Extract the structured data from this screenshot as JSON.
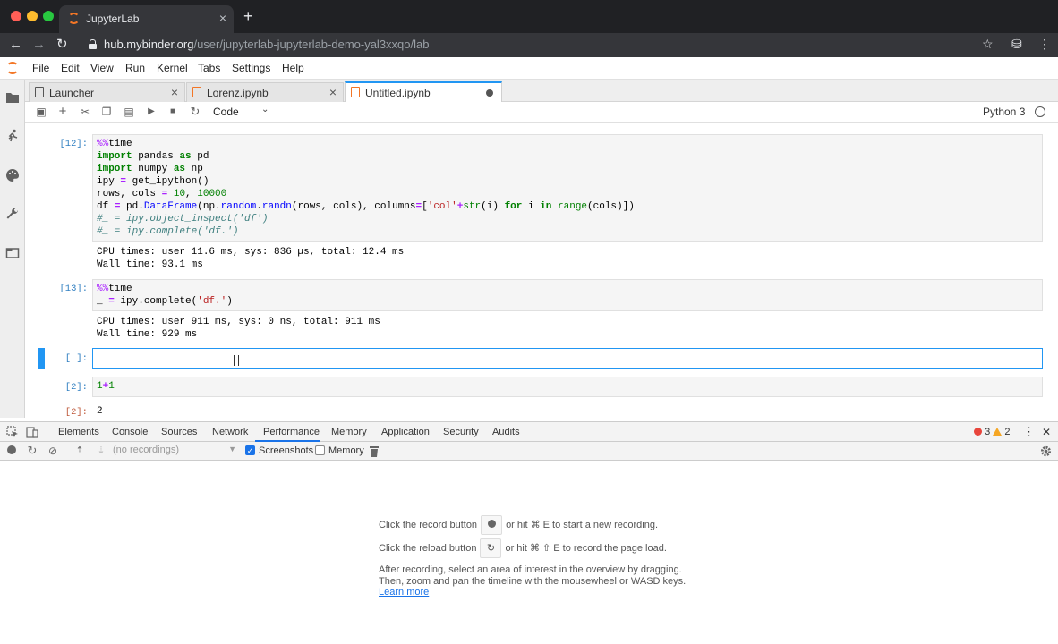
{
  "browser": {
    "tab_title": "JupyterLab",
    "tab_close": "×",
    "new_tab": "+",
    "back": "←",
    "forward": "→",
    "reload": "↻",
    "url_host": "hub.mybinder.org",
    "url_path": "/user/jupyterlab-jupyterlab-demo-yal3xxqo/lab",
    "star": "☆",
    "incognito": "⛁",
    "kebab": "⋮"
  },
  "menu": {
    "items": [
      "File",
      "Edit",
      "View",
      "Run",
      "Kernel",
      "Tabs",
      "Settings",
      "Help"
    ]
  },
  "sidebar": {
    "icons": [
      "folder-icon",
      "running-icon",
      "palette-icon",
      "wrench-icon",
      "tabs-icon"
    ]
  },
  "dock": {
    "tabs": [
      {
        "label": "Launcher",
        "close": "×"
      },
      {
        "label": "Lorenz.ipynb",
        "close": "×"
      },
      {
        "label": "Untitled.ipynb"
      }
    ]
  },
  "toolbar": {
    "cell_type": "Code",
    "kernel": "Python 3",
    "icons": {
      "save": "▣",
      "add": "+",
      "cut": "✂",
      "copy": "❐",
      "paste": "▤",
      "run": "▶",
      "stop": "■",
      "restart": "↻",
      "chev": "⌄"
    }
  },
  "cells": [
    {
      "prompt": "[12]:",
      "output": "CPU times: user 11.6 ms, sys: 836 µs, total: 12.4 ms\nWall time: 93.1 ms"
    },
    {
      "prompt": "[13]:",
      "output": "CPU times: user 911 ms, sys: 0 ns, total: 911 ms\nWall time: 929 ms"
    },
    {
      "prompt": "[ ]:"
    },
    {
      "prompt": "[2]:",
      "out_prompt": "[2]:",
      "output": "2"
    }
  ],
  "devtools": {
    "tabs": [
      "Elements",
      "Console",
      "Sources",
      "Network",
      "Performance",
      "Memory",
      "Application",
      "Security",
      "Audits"
    ],
    "errors": "3",
    "warnings": "2",
    "more": "⋮",
    "close": "✕",
    "recordings_placeholder": "(no recordings)",
    "chk_screenshots": "Screenshots",
    "chk_memory": "Memory",
    "hint1_pre": "Click the record button",
    "hint1_post": "or hit ⌘ E to start a new recording.",
    "hint2_pre": "Click the reload button",
    "hint2_post": "or hit ⌘ ⇧ E to record the page load.",
    "hint3_line1": "After recording, select an area of interest in the overview by dragging.",
    "hint3_line2": "Then, zoom and pan the timeline with the mousewheel or WASD keys.",
    "learn_more": "Learn more"
  }
}
